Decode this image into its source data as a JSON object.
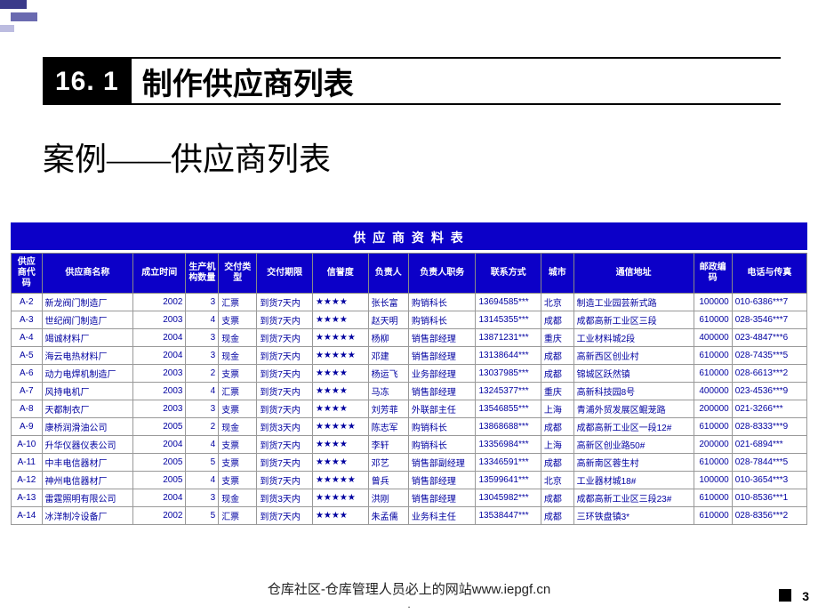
{
  "slide": {
    "section_number": "16. 1",
    "section_title": "制作供应商列表",
    "subtitle": "案例——供应商列表",
    "footer": "仓库社区-仓库管理人员必上的网站www.iepgf.cn",
    "page_number": "3"
  },
  "sheet": {
    "title": "供 应 商 资 料 表",
    "headers": {
      "code": "供应商代码",
      "name": "供应商名称",
      "est": "成立时间",
      "qty": "生产机构数量",
      "pay": "交付类型",
      "term": "交付期限",
      "rep": "信誉度",
      "per": "负责人",
      "job": "负责人职务",
      "tel": "联系方式",
      "city": "城市",
      "addr": "通信地址",
      "zip": "邮政编码",
      "fax": "电话与传真"
    },
    "rows": [
      {
        "code": "A-2",
        "name": "新龙阀门制造厂",
        "est": "2002",
        "qty": "3",
        "pay": "汇票",
        "term": "到货7天内",
        "rep": "★★★★",
        "per": "张长富",
        "job": "购销科长",
        "tel": "13694585***",
        "city": "北京",
        "addr": "制造工业园芸新式路",
        "zip": "100000",
        "fax": "010-6386***7"
      },
      {
        "code": "A-3",
        "name": "世纪阀门制造厂",
        "est": "2003",
        "qty": "4",
        "pay": "支票",
        "term": "到货7天内",
        "rep": "★★★★",
        "per": "赵天明",
        "job": "购销科长",
        "tel": "13145355***",
        "city": "成都",
        "addr": "成都高新工业区三段",
        "zip": "610000",
        "fax": "028-3546***7"
      },
      {
        "code": "A-4",
        "name": "竭诚材料厂",
        "est": "2004",
        "qty": "3",
        "pay": "现金",
        "term": "到货7天内",
        "rep": "★★★★★",
        "per": "杨柳",
        "job": "销售部经理",
        "tel": "13871231***",
        "city": "重庆",
        "addr": "工业材料城2段",
        "zip": "400000",
        "fax": "023-4847***6"
      },
      {
        "code": "A-5",
        "name": "海云电热材料厂",
        "est": "2004",
        "qty": "3",
        "pay": "现金",
        "term": "到货7天内",
        "rep": "★★★★★",
        "per": "邓建",
        "job": "销售部经理",
        "tel": "13138644***",
        "city": "成都",
        "addr": "高新西区创业村",
        "zip": "610000",
        "fax": "028-7435***5"
      },
      {
        "code": "A-6",
        "name": "动力电焊机制造厂",
        "est": "2003",
        "qty": "2",
        "pay": "支票",
        "term": "到货7天内",
        "rep": "★★★★",
        "per": "杨运飞",
        "job": "业务部经理",
        "tel": "13037985***",
        "city": "成都",
        "addr": "锦城区跃然镇",
        "zip": "610000",
        "fax": "028-6613***2"
      },
      {
        "code": "A-7",
        "name": "风持电机厂",
        "est": "2003",
        "qty": "4",
        "pay": "汇票",
        "term": "到货7天内",
        "rep": "★★★★",
        "per": "马冻",
        "job": "销售部经理",
        "tel": "13245377***",
        "city": "重庆",
        "addr": "高新科技园8号",
        "zip": "400000",
        "fax": "023-4536***9"
      },
      {
        "code": "A-8",
        "name": "天都制衣厂",
        "est": "2003",
        "qty": "3",
        "pay": "支票",
        "term": "到货7天内",
        "rep": "★★★★",
        "per": "刘芳菲",
        "job": "外联部主任",
        "tel": "13546855***",
        "city": "上海",
        "addr": "青浦外贸发展区鲲茏路",
        "zip": "200000",
        "fax": "021-3266***"
      },
      {
        "code": "A-9",
        "name": "康桥润滑油公司",
        "est": "2005",
        "qty": "2",
        "pay": "现金",
        "term": "到货3天内",
        "rep": "★★★★★",
        "per": "陈志军",
        "job": "购销科长",
        "tel": "13868688***",
        "city": "成都",
        "addr": "成都高新工业区一段12#",
        "zip": "610000",
        "fax": "028-8333***9"
      },
      {
        "code": "A-10",
        "name": "升华仪器仪表公司",
        "est": "2004",
        "qty": "4",
        "pay": "支票",
        "term": "到货7天内",
        "rep": "★★★★",
        "per": "李轩",
        "job": "购销科长",
        "tel": "13356984***",
        "city": "上海",
        "addr": "高新区创业路50#",
        "zip": "200000",
        "fax": "021-6894***"
      },
      {
        "code": "A-11",
        "name": "中丰电信器材厂",
        "est": "2005",
        "qty": "5",
        "pay": "支票",
        "term": "到货7天内",
        "rep": "★★★★",
        "per": "邓艺",
        "job": "销售部副经理",
        "tel": "13346591***",
        "city": "成都",
        "addr": "高新南区蓉生村",
        "zip": "610000",
        "fax": "028-7844***5"
      },
      {
        "code": "A-12",
        "name": "神州电信器材厂",
        "est": "2005",
        "qty": "4",
        "pay": "支票",
        "term": "到货7天内",
        "rep": "★★★★★",
        "per": "曾兵",
        "job": "销售部经理",
        "tel": "13599641***",
        "city": "北京",
        "addr": "工业器材城18#",
        "zip": "100000",
        "fax": "010-3654***3"
      },
      {
        "code": "A-13",
        "name": "雷霆照明有限公司",
        "est": "2004",
        "qty": "3",
        "pay": "现金",
        "term": "到货3天内",
        "rep": "★★★★★",
        "per": "洪刚",
        "job": "销售部经理",
        "tel": "13045982***",
        "city": "成都",
        "addr": "成都高新工业区三段23#",
        "zip": "610000",
        "fax": "010-8536***1"
      },
      {
        "code": "A-14",
        "name": "冰洋制冷设备厂",
        "est": "2002",
        "qty": "5",
        "pay": "汇票",
        "term": "到货7天内",
        "rep": "★★★★",
        "per": "朱孟儒",
        "job": "业务科主任",
        "tel": "13538447***",
        "city": "成都",
        "addr": "三环铁盘镇3*",
        "zip": "610000",
        "fax": "028-8356***2"
      }
    ]
  }
}
